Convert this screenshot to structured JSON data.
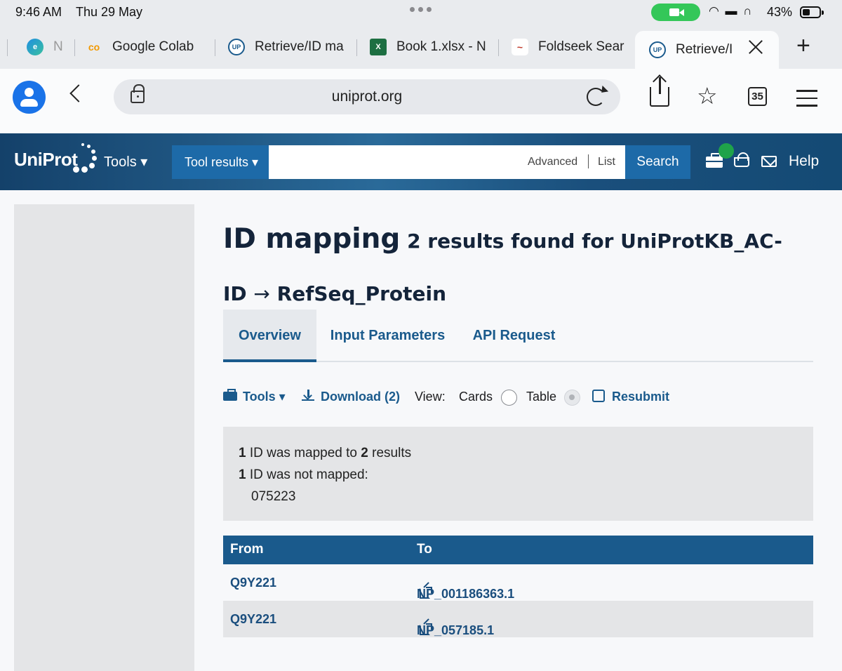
{
  "status_bar": {
    "time": "9:46 AM",
    "date": "Thu 29 May",
    "battery": "43%"
  },
  "browser_tabs": [
    {
      "title": "N",
      "icon": "edge-icon"
    },
    {
      "title": "Google Colab",
      "icon": "colab-icon"
    },
    {
      "title": "Retrieve/ID ma",
      "icon": "uniprot-icon"
    },
    {
      "title": "Book 1.xlsx - N",
      "icon": "excel-icon"
    },
    {
      "title": "Foldseek Sear",
      "icon": "foldseek-icon"
    },
    {
      "title": "Retrieve/I",
      "icon": "uniprot-icon",
      "active": true
    }
  ],
  "address_bar": {
    "url": "uniprot.org",
    "tab_count": "35"
  },
  "uniprot_header": {
    "logo": "UniProt",
    "tools_label": "Tools",
    "scope_label": "Tool results",
    "advanced_label": "Advanced",
    "list_label": "List",
    "search_label": "Search",
    "help_label": "Help"
  },
  "page": {
    "title_main": "ID mapping",
    "title_sub_line1": "2 results found for UniProtKB_AC-",
    "title_sub_line2_prefix": "ID",
    "title_arrow": "→",
    "title_sub_line2_suffix": "RefSeq_Protein",
    "tabs": [
      "Overview",
      "Input Parameters",
      "API Request"
    ],
    "actions": {
      "tools": "Tools",
      "download": "Download (2)",
      "view_label": "View:",
      "cards_label": "Cards",
      "table_label": "Table",
      "resubmit": "Resubmit"
    },
    "summary": {
      "mapped_count": "1",
      "mapped_text_a": "ID was mapped to",
      "mapped_results": "2",
      "mapped_text_b": "results",
      "unmapped_count": "1",
      "unmapped_text": "ID was not mapped:",
      "unmapped_id": "075223"
    },
    "table": {
      "headers": [
        "From",
        "To"
      ],
      "rows": [
        {
          "from": "Q9Y221",
          "to": "NP_001186363.1"
        },
        {
          "from": "Q9Y221",
          "to": "NP_057185.1"
        }
      ]
    }
  }
}
